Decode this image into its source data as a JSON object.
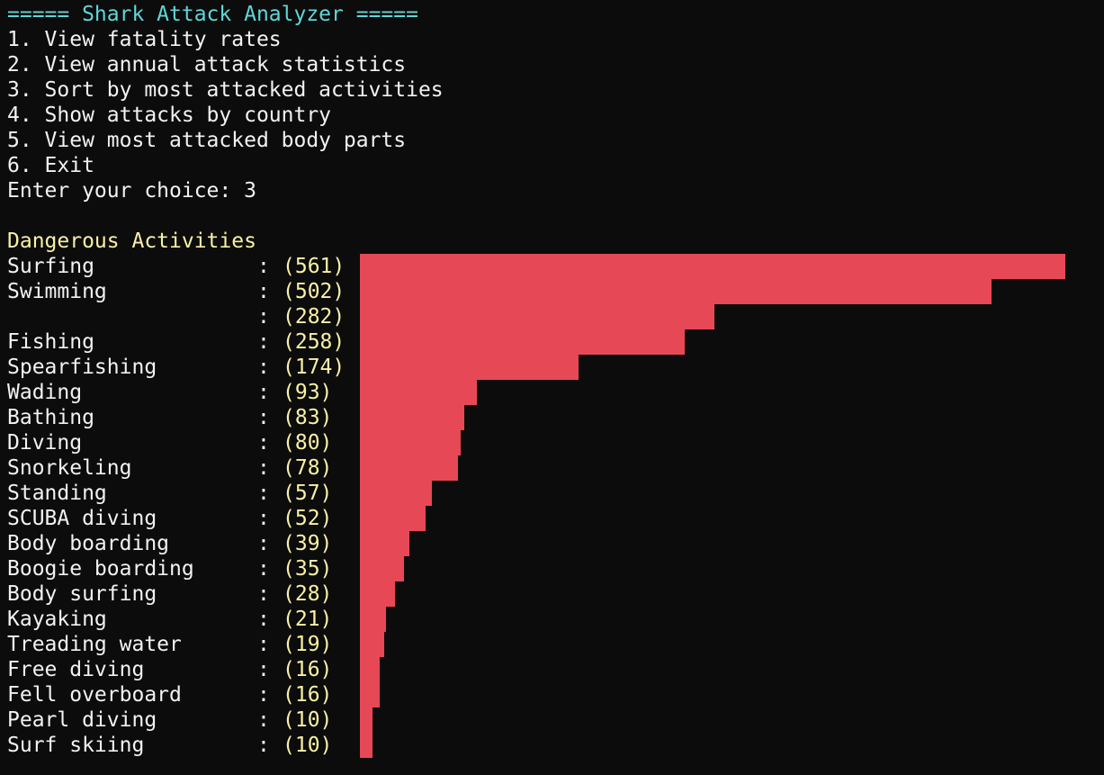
{
  "header": {
    "title": "===== Shark Attack Analyzer ====="
  },
  "menu": {
    "items": [
      "1. View fatality rates",
      "2. View annual attack statistics",
      "3. Sort by most attacked activities",
      "4. Show attacks by country",
      "5. View most attacked body parts",
      "6. Exit"
    ],
    "prompt": "Enter your choice: 3"
  },
  "section": {
    "title": "Dangerous Activities",
    "separator": ":"
  },
  "colors": {
    "background": "#0c0c0c",
    "text": "#f2f2f2",
    "title": "#61d6d6",
    "section": "#f9f1a5",
    "count": "#f9f1a5",
    "bar": "#e74856"
  },
  "chart_data": {
    "type": "bar",
    "orientation": "horizontal",
    "title": "Dangerous Activities",
    "categories": [
      "Surfing",
      "Swimming",
      "",
      "Fishing",
      "Spearfishing",
      "Wading",
      "Bathing",
      "Diving",
      "Snorkeling",
      "Standing",
      "SCUBA diving",
      "Body boarding",
      "Boogie boarding",
      "Body surfing",
      "Kayaking",
      "Treading water",
      "Free diving",
      "Fell overboard",
      "Pearl diving",
      "Surf skiing"
    ],
    "values": [
      561,
      502,
      282,
      258,
      174,
      93,
      83,
      80,
      78,
      57,
      52,
      39,
      35,
      28,
      21,
      19,
      16,
      16,
      10,
      10
    ],
    "count_labels": [
      "(561)",
      "(502)",
      "(282)",
      "(258)",
      "(174)",
      "(93)",
      "(83)",
      "(80)",
      "(78)",
      "(57)",
      "(52)",
      "(39)",
      "(35)",
      "(28)",
      "(21)",
      "(19)",
      "(16)",
      "(16)",
      "(10)",
      "(10)"
    ]
  }
}
